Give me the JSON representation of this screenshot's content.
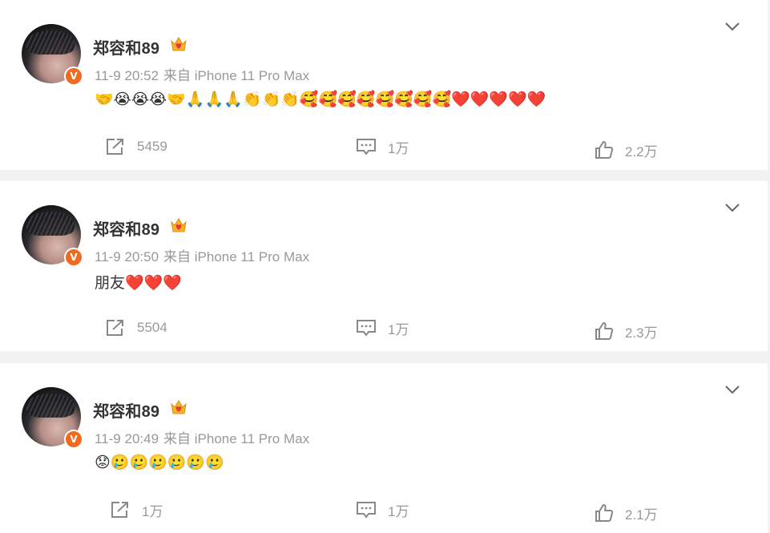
{
  "posts": [
    {
      "user": "郑容和89",
      "time": "11-9 20:52",
      "source": "来自 iPhone 11 Pro Max",
      "content": "🤝😭😭😭🤝🙏🙏🙏👏👏👏🥰🥰🥰🥰🥰🥰🥰🥰❤️❤️❤️❤️❤️",
      "share_count": "5459",
      "comment_count": "1万",
      "like_count": "2.2万"
    },
    {
      "user": "郑容和89",
      "time": "11-9 20:50",
      "source": "来自 iPhone 11 Pro Max",
      "content": "朋友❤️❤️❤️",
      "share_count": "5504",
      "comment_count": "1万",
      "like_count": "2.3万"
    },
    {
      "user": "郑容和89",
      "time": "11-9 20:49",
      "source": "来自 iPhone 11 Pro Max",
      "content": "😟🥲🥲🥲🥲🥲🥲",
      "share_count": "1万",
      "comment_count": "1万",
      "like_count": "2.1万"
    }
  ],
  "icons": {
    "verified_badge": "v-badge-icon",
    "member_crown": "crown-heart-icon",
    "more": "chevron-down-icon",
    "share": "share-icon",
    "comment": "comment-icon",
    "like": "thumbs-up-icon"
  },
  "colors": {
    "accent_orange": "#f06a1f",
    "crown_gold": "#f5b325",
    "text_main": "#333333",
    "text_muted": "#999999"
  }
}
